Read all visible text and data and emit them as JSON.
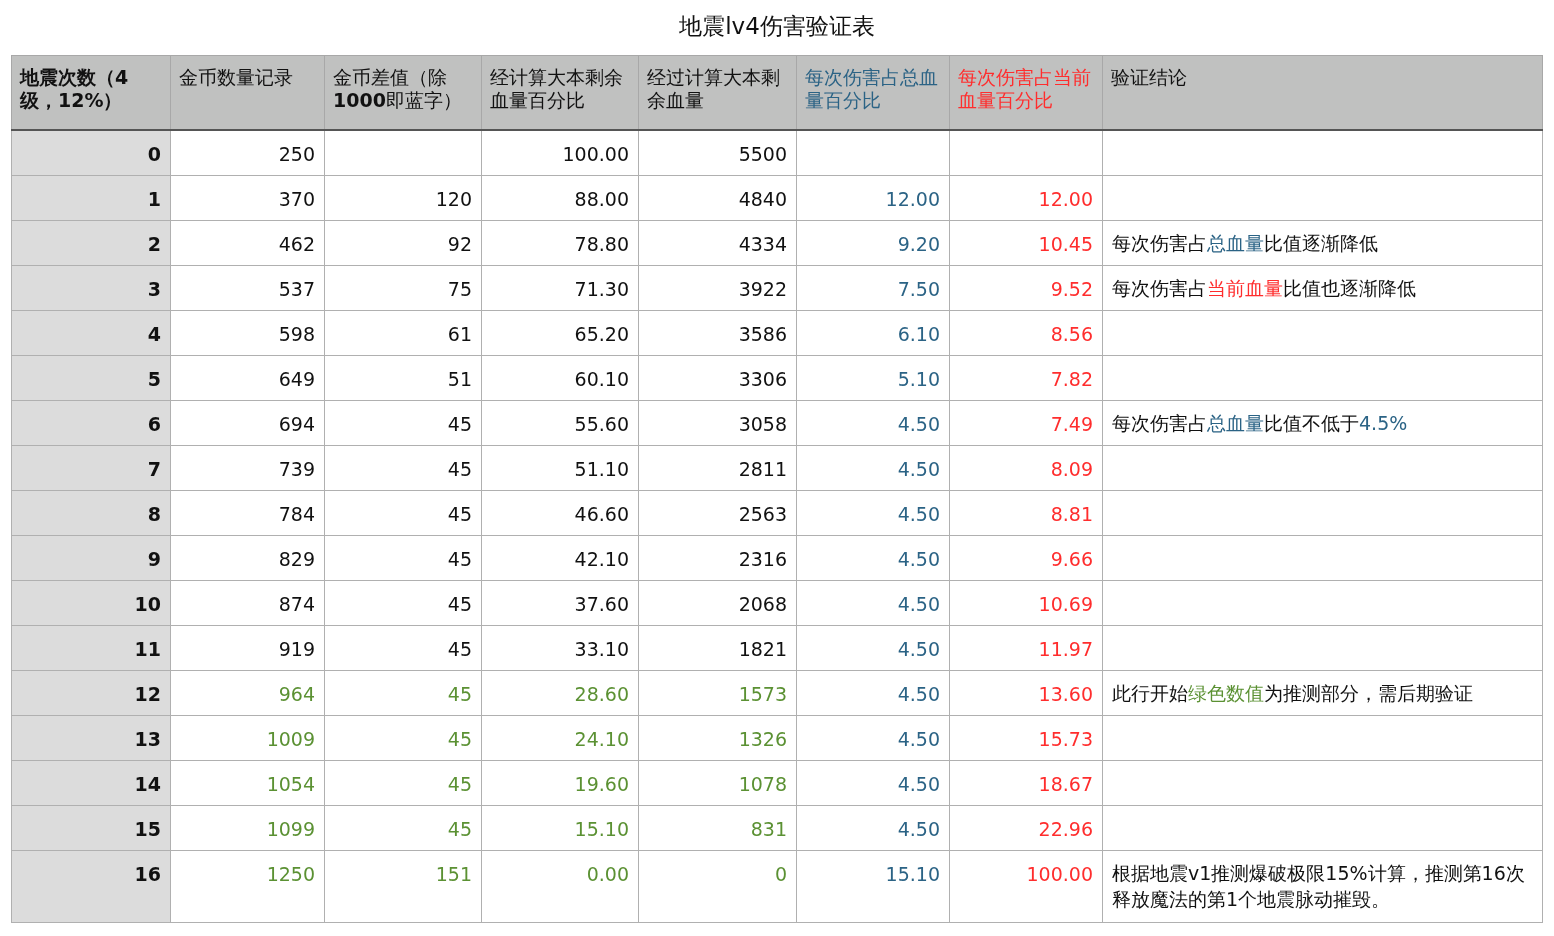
{
  "title": "地震lv4伤害验证表",
  "columns": [
    {
      "label": "地震次数（4级，12%）",
      "kind": "index"
    },
    {
      "label": "金币数量记录",
      "kind": "number"
    },
    {
      "label": "金币差值（除**1000**即蓝字）",
      "kind": "number"
    },
    {
      "label": "经计算大本剩余血量百分比",
      "kind": "number"
    },
    {
      "label": "经过计算大本剩余血量",
      "kind": "number"
    },
    {
      "label": "每次伤害占总血量百分比",
      "kind": "total"
    },
    {
      "label": "每次伤害占当前血量百分比",
      "kind": "current"
    },
    {
      "label": "验证结论",
      "kind": "note"
    }
  ],
  "rows": [
    {
      "cells": [
        "0",
        "250",
        "",
        "100.00",
        "5500",
        "",
        ""
      ],
      "guess": false,
      "conclusion": []
    },
    {
      "cells": [
        "1",
        "370",
        "120",
        "88.00",
        "4840",
        "12.00",
        "12.00"
      ],
      "guess": false,
      "conclusion": []
    },
    {
      "cells": [
        "2",
        "462",
        "92",
        "78.80",
        "4334",
        "9.20",
        "10.45"
      ],
      "guess": false,
      "conclusion": [
        {
          "text": "每次伤害占",
          "kind": "plain"
        },
        {
          "text": "总血量",
          "kind": "total"
        },
        {
          "text": "比值逐渐降低",
          "kind": "plain"
        }
      ]
    },
    {
      "cells": [
        "3",
        "537",
        "75",
        "71.30",
        "3922",
        "7.50",
        "9.52"
      ],
      "guess": false,
      "conclusion": [
        {
          "text": "每次伤害占",
          "kind": "plain"
        },
        {
          "text": "当前血量",
          "kind": "current"
        },
        {
          "text": "比值也逐渐降低",
          "kind": "plain"
        }
      ]
    },
    {
      "cells": [
        "4",
        "598",
        "61",
        "65.20",
        "3586",
        "6.10",
        "8.56"
      ],
      "guess": false,
      "conclusion": []
    },
    {
      "cells": [
        "5",
        "649",
        "51",
        "60.10",
        "3306",
        "5.10",
        "7.82"
      ],
      "guess": false,
      "conclusion": []
    },
    {
      "cells": [
        "6",
        "694",
        "45",
        "55.60",
        "3058",
        "4.50",
        "7.49"
      ],
      "guess": false,
      "conclusion": [
        {
          "text": "每次伤害占",
          "kind": "plain"
        },
        {
          "text": "总血量",
          "kind": "total"
        },
        {
          "text": "比值不低于",
          "kind": "plain"
        },
        {
          "text": "4.5%",
          "kind": "total"
        }
      ]
    },
    {
      "cells": [
        "7",
        "739",
        "45",
        "51.10",
        "2811",
        "4.50",
        "8.09"
      ],
      "guess": false,
      "conclusion": []
    },
    {
      "cells": [
        "8",
        "784",
        "45",
        "46.60",
        "2563",
        "4.50",
        "8.81"
      ],
      "guess": false,
      "conclusion": []
    },
    {
      "cells": [
        "9",
        "829",
        "45",
        "42.10",
        "2316",
        "4.50",
        "9.66"
      ],
      "guess": false,
      "conclusion": []
    },
    {
      "cells": [
        "10",
        "874",
        "45",
        "37.60",
        "2068",
        "4.50",
        "10.69"
      ],
      "guess": false,
      "conclusion": []
    },
    {
      "cells": [
        "11",
        "919",
        "45",
        "33.10",
        "1821",
        "4.50",
        "11.97"
      ],
      "guess": false,
      "conclusion": []
    },
    {
      "cells": [
        "12",
        "964",
        "45",
        "28.60",
        "1573",
        "4.50",
        "13.60"
      ],
      "guess": true,
      "conclusion": [
        {
          "text": "此行开始",
          "kind": "plain"
        },
        {
          "text": "绿色数值",
          "kind": "guess"
        },
        {
          "text": "为推测部分，需后期验证",
          "kind": "plain"
        }
      ]
    },
    {
      "cells": [
        "13",
        "1009",
        "45",
        "24.10",
        "1326",
        "4.50",
        "15.73"
      ],
      "guess": true,
      "conclusion": []
    },
    {
      "cells": [
        "14",
        "1054",
        "45",
        "19.60",
        "1078",
        "4.50",
        "18.67"
      ],
      "guess": true,
      "conclusion": []
    },
    {
      "cells": [
        "15",
        "1099",
        "45",
        "15.10",
        "831",
        "4.50",
        "22.96"
      ],
      "guess": true,
      "conclusion": []
    },
    {
      "cells": [
        "16",
        "1250",
        "151",
        "0.00",
        "0",
        "15.10",
        "100.00"
      ],
      "guess": true,
      "conclusion": [
        {
          "text": "根据地震v1推测爆破极限15%计算，推测第16次释放魔法的第1个地震脉动摧毁。",
          "kind": "plain"
        }
      ]
    }
  ]
}
